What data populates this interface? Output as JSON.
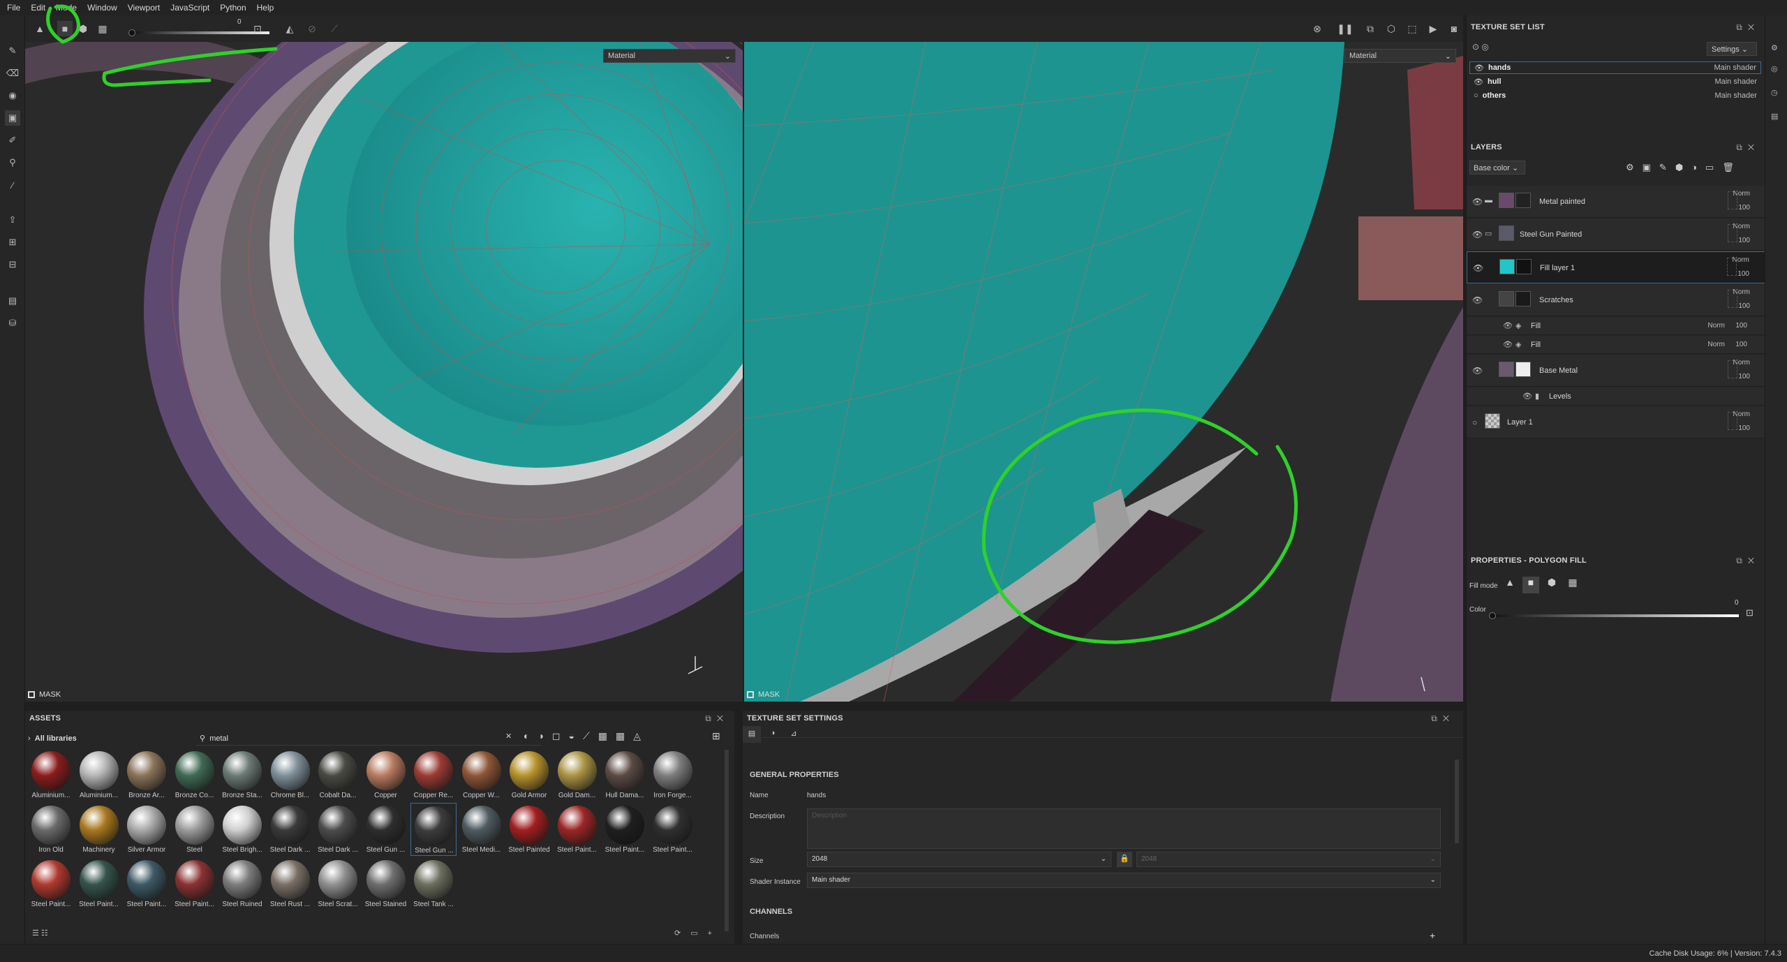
{
  "menu": [
    "File",
    "Edit",
    "Mode",
    "Window",
    "Viewport",
    "JavaScript",
    "Python",
    "Help"
  ],
  "toolbar": {
    "slider_value": "0"
  },
  "viewport_left": {
    "material_label": "Material",
    "mask_label": "MASK"
  },
  "viewport_right": {
    "material_label": "Material",
    "mask_label": "MASK"
  },
  "texture_set_list": {
    "title": "TEXTURE SET LIST",
    "settings_label": "Settings",
    "items": [
      {
        "name": "hands",
        "shader": "Main shader"
      },
      {
        "name": "hull",
        "shader": "Main shader"
      },
      {
        "name": "others",
        "shader": "Main shader"
      }
    ]
  },
  "layers": {
    "title": "LAYERS",
    "channel": "Base color",
    "items": [
      {
        "name": "Metal painted",
        "blend": "Norm",
        "opacity": "100"
      },
      {
        "name": "Steel Gun Painted",
        "blend": "Norm",
        "opacity": "100"
      },
      {
        "name": "Fill layer 1",
        "blend": "Norm",
        "opacity": "100"
      },
      {
        "name": "Scratches",
        "blend": "Norm",
        "opacity": "100"
      },
      {
        "name": "Fill",
        "blend": "Norm",
        "opacity": "100"
      },
      {
        "name": "Fill",
        "blend": "Norm",
        "opacity": "100"
      },
      {
        "name": "Base Metal",
        "blend": "Norm",
        "opacity": "100"
      },
      {
        "name": "Levels"
      },
      {
        "name": "Layer 1",
        "blend": "Norm",
        "opacity": "100"
      }
    ]
  },
  "properties": {
    "title": "PROPERTIES - POLYGON FILL",
    "fill_mode_label": "Fill mode",
    "color_label": "Color",
    "color_value": "0"
  },
  "assets": {
    "title": "ASSETS",
    "library": "All libraries",
    "search": "metal",
    "items": [
      "Aluminium...",
      "Aluminium...",
      "Bronze Ar...",
      "Bronze Co...",
      "Bronze Sta...",
      "Chrome Bl...",
      "Cobalt Da...",
      "Copper",
      "Copper Re...",
      "Copper W...",
      "Gold Armor",
      "Gold Dam...",
      "Hull Dama...",
      "Iron Forge...",
      "Iron Old",
      "Machinery",
      "Silver Armor",
      "Steel",
      "Steel Brigh...",
      "Steel Dark ...",
      "Steel Dark ...",
      "Steel Gun ...",
      "Steel Gun ...",
      "Steel Medi...",
      "Steel Painted",
      "Steel Paint...",
      "Steel Paint...",
      "Steel Paint...",
      "Steel Paint...",
      "Steel Paint...",
      "Steel Paint...",
      "Steel Paint...",
      "Steel Ruined",
      "Steel Rust ...",
      "Steel Scrat...",
      "Steel Stained",
      "Steel Tank ..."
    ],
    "colors": [
      "#8a1d1d",
      "#b5b5b5",
      "#8a7358",
      "#3f6a55",
      "#6b7a74",
      "#7f8f99",
      "#4a4a44",
      "#b87a5f",
      "#9a3b33",
      "#8d5637",
      "#b6922c",
      "#a99343",
      "#5a4a44",
      "#7d7d7d",
      "#6a6a6a",
      "#a8781f",
      "#aaa",
      "#9c9c9c",
      "#cfcfcf",
      "#3a3a3a",
      "#4c4c4c",
      "#2e2e2e",
      "#3c3c3c",
      "#4f5b60",
      "#a21f1f",
      "#9b2626",
      "#1f1f1f",
      "#303030",
      "#b0392f",
      "#35544c",
      "#3d5a66",
      "#8a3232",
      "#7c7c7c",
      "#7a6f66",
      "#8f8f8f",
      "#6e6e6e",
      "#6c6e5e"
    ]
  },
  "texture_set_settings": {
    "title": "TEXTURE SET SETTINGS",
    "general": "GENERAL PROPERTIES",
    "name_label": "Name",
    "name_value": "hands",
    "desc_label": "Description",
    "desc_placeholder": "Description",
    "size_label": "Size",
    "size_value": "2048",
    "size_value2": "2048",
    "shader_label": "Shader Instance",
    "shader_value": "Main shader",
    "channels_title": "CHANNELS",
    "channels_label": "Channels"
  },
  "status": {
    "text": "Cache Disk Usage:    6% | Version: 7.4.3"
  }
}
